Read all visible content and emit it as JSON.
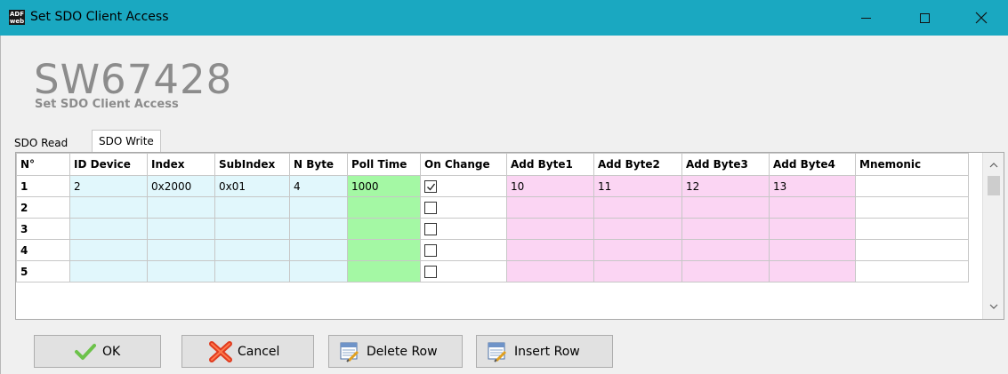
{
  "window": {
    "title": "Set SDO Client Access",
    "icon_text_top": "ADF",
    "icon_text_bottom": "web"
  },
  "header": {
    "product_code": "SW67428",
    "subtitle": "Set SDO Client Access"
  },
  "tabs": [
    {
      "label": "SDO Read",
      "active": false
    },
    {
      "label": "SDO Write",
      "active": true
    }
  ],
  "grid": {
    "columns": [
      "N°",
      "ID Device",
      "Index",
      "SubIndex",
      "N Byte",
      "Poll Time",
      "On Change",
      "Add Byte1",
      "Add Byte2",
      "Add Byte3",
      "Add Byte4",
      "Mnemonic"
    ],
    "rows": [
      {
        "n": "1",
        "id_device": "2",
        "index": "0x2000",
        "subindex": "0x01",
        "n_byte": "4",
        "poll_time": "1000",
        "on_change": true,
        "add_byte1": "10",
        "add_byte2": "11",
        "add_byte3": "12",
        "add_byte4": "13",
        "mnemonic": ""
      },
      {
        "n": "2",
        "id_device": "",
        "index": "",
        "subindex": "",
        "n_byte": "",
        "poll_time": "",
        "on_change": false,
        "add_byte1": "",
        "add_byte2": "",
        "add_byte3": "",
        "add_byte4": "",
        "mnemonic": ""
      },
      {
        "n": "3",
        "id_device": "",
        "index": "",
        "subindex": "",
        "n_byte": "",
        "poll_time": "",
        "on_change": false,
        "add_byte1": "",
        "add_byte2": "",
        "add_byte3": "",
        "add_byte4": "",
        "mnemonic": ""
      },
      {
        "n": "4",
        "id_device": "",
        "index": "",
        "subindex": "",
        "n_byte": "",
        "poll_time": "",
        "on_change": false,
        "add_byte1": "",
        "add_byte2": "",
        "add_byte3": "",
        "add_byte4": "",
        "mnemonic": ""
      },
      {
        "n": "5",
        "id_device": "",
        "index": "",
        "subindex": "",
        "n_byte": "",
        "poll_time": "",
        "on_change": false,
        "add_byte1": "",
        "add_byte2": "",
        "add_byte3": "",
        "add_byte4": "",
        "mnemonic": ""
      }
    ]
  },
  "buttons": {
    "ok": "OK",
    "cancel": "Cancel",
    "delete_row": "Delete Row",
    "insert_row": "Insert Row"
  },
  "colors": {
    "titlebar": "#1aa8c1",
    "cell_blue": "#e1f7fc",
    "cell_green": "#a4f8a4",
    "cell_pink": "#fbd5f3"
  }
}
